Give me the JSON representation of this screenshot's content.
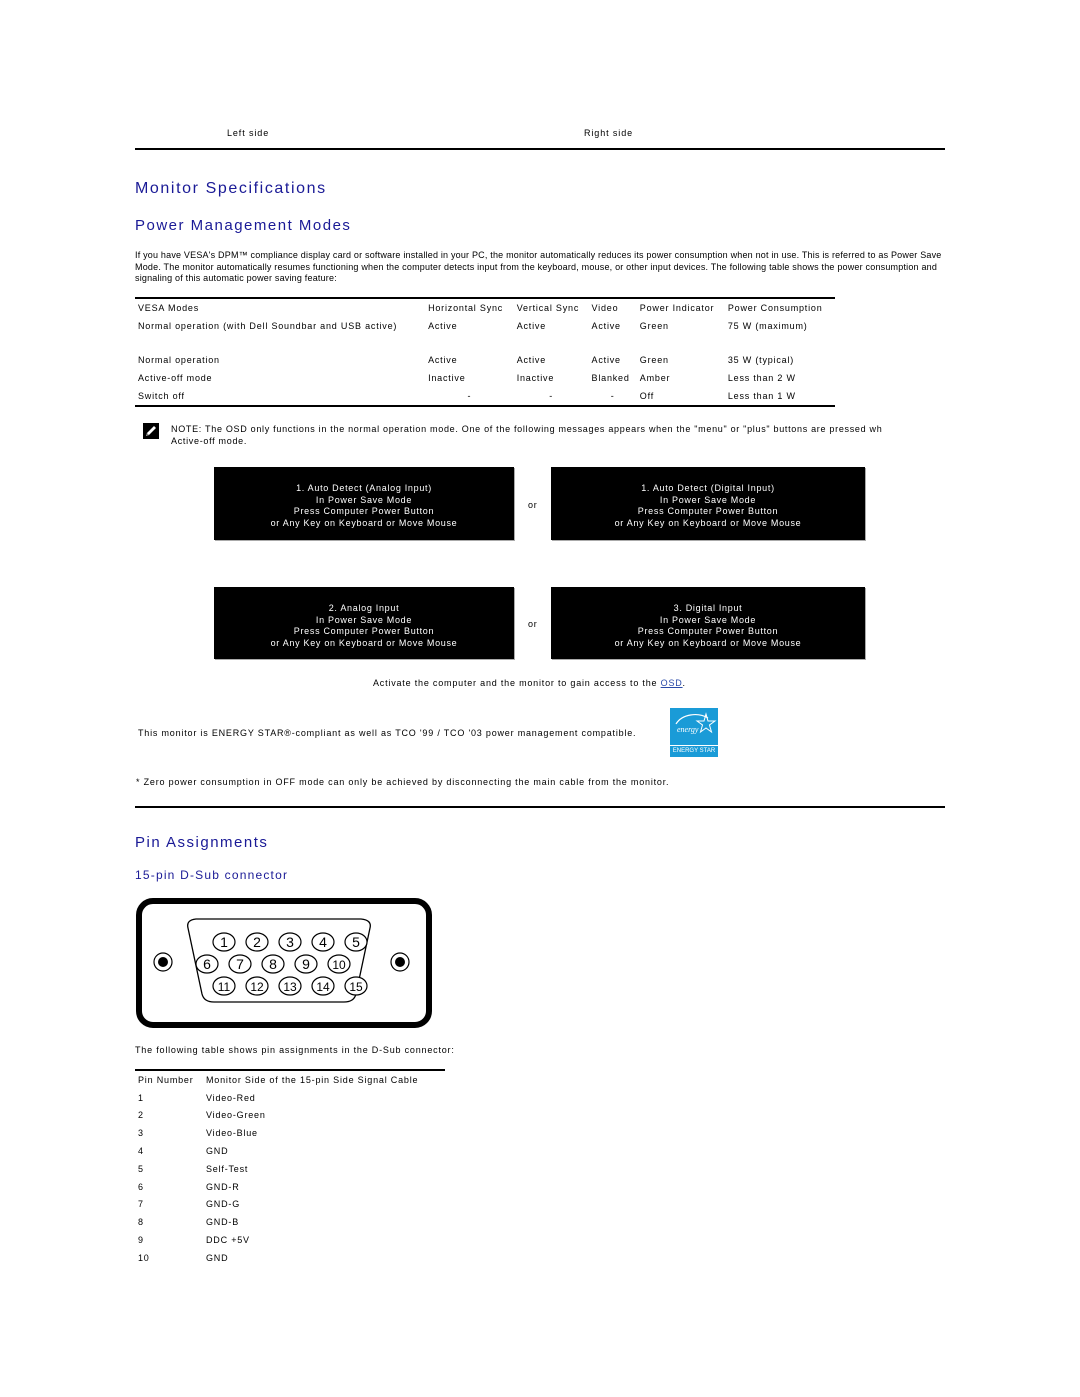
{
  "top_nav": {
    "left_label": "Left side",
    "right_label": "Right side"
  },
  "page_title": "Monitor Specifications",
  "power_section": {
    "heading": "Power Management Modes",
    "intro": "If you have VESA's DPM™ compliance display card or software installed in your PC, the monitor automatically reduces its power consumption when not in use. This is referred to as Power Save Mode. The monitor automatically resumes functioning when the computer detects input from the keyboard, mouse, or other input devices. The following table shows the power consumption and signaling of this automatic power saving feature:",
    "table": {
      "headers": [
        "VESA Modes",
        "Horizontal Sync",
        "Vertical Sync",
        "Video",
        "Power Indicator",
        "Power Consumption"
      ],
      "rows": [
        [
          "Normal operation (with Dell Soundbar and USB active)",
          "Active",
          "Active",
          "Active",
          "Green",
          "75 W (maximum)"
        ],
        [
          "Normal operation",
          "Active",
          "Active",
          "Active",
          "Green",
          "35 W (typical)"
        ],
        [
          "Active-off mode",
          "Inactive",
          "Inactive",
          "Blanked",
          "Amber",
          "Less than 2 W"
        ],
        [
          "Switch off",
          "-",
          "-",
          "-",
          "Off",
          "Less than 1 W"
        ]
      ]
    },
    "note_line1": "NOTE: The OSD only functions in the normal operation mode. One of the following messages appears when the \"menu\" or \"plus\" buttons are pressed wh",
    "note_line2": "Active-off mode.",
    "osd_messages": [
      {
        "title": "1. Auto Detect (Analog Input)",
        "line2": "In Power Save Mode",
        "line3": "Press Computer Power Button",
        "line4": "or Any Key on Keyboard or Move Mouse"
      },
      {
        "title": "1. Auto Detect (Digital Input)",
        "line2": "In Power Save Mode",
        "line3": "Press Computer Power Button",
        "line4": "or Any Key on Keyboard or Move Mouse"
      },
      {
        "title": "2. Analog Input",
        "line2": "In Power Save Mode",
        "line3": "Press Computer Power Button",
        "line4": "or Any Key on Keyboard or Move Mouse"
      },
      {
        "title": "3. Digital Input",
        "line2": "In Power Save Mode",
        "line3": "Press Computer Power Button",
        "line4": "or Any Key on Keyboard or Move Mouse"
      }
    ],
    "or_label": "or",
    "activate_text": "Activate the computer and the monitor to gain access to the ",
    "osd_link": "OSD",
    "activate_end": ".",
    "energy_text": "This monitor is ENERGY STAR®-compliant as well as TCO '99 / TCO '03 power management compatible.",
    "energy_logo_label": "ENERGY STAR",
    "energy_logo_script": "energy",
    "footnote": "* Zero power consumption in OFF mode can only be achieved by disconnecting the main cable from the monitor."
  },
  "pin_section": {
    "heading": "Pin Assignments",
    "subheading": "15-pin D-Sub connector",
    "connector_pins": [
      "1",
      "2",
      "3",
      "4",
      "5",
      "6",
      "7",
      "8",
      "9",
      "10",
      "11",
      "12",
      "13",
      "14",
      "15"
    ],
    "intro": "The following table shows pin assignments in the D-Sub connector:",
    "table": {
      "headers": [
        "Pin Number",
        "Monitor Side of the 15-pin Side Signal Cable"
      ],
      "rows": [
        [
          "1",
          "Video-Red"
        ],
        [
          "2",
          "Video-Green"
        ],
        [
          "3",
          "Video-Blue"
        ],
        [
          "4",
          "GND"
        ],
        [
          "5",
          "Self-Test"
        ],
        [
          "6",
          "GND-R"
        ],
        [
          "7",
          "GND-G"
        ],
        [
          "8",
          "GND-B"
        ],
        [
          "9",
          "DDC +5V"
        ],
        [
          "10",
          "GND"
        ]
      ]
    }
  }
}
